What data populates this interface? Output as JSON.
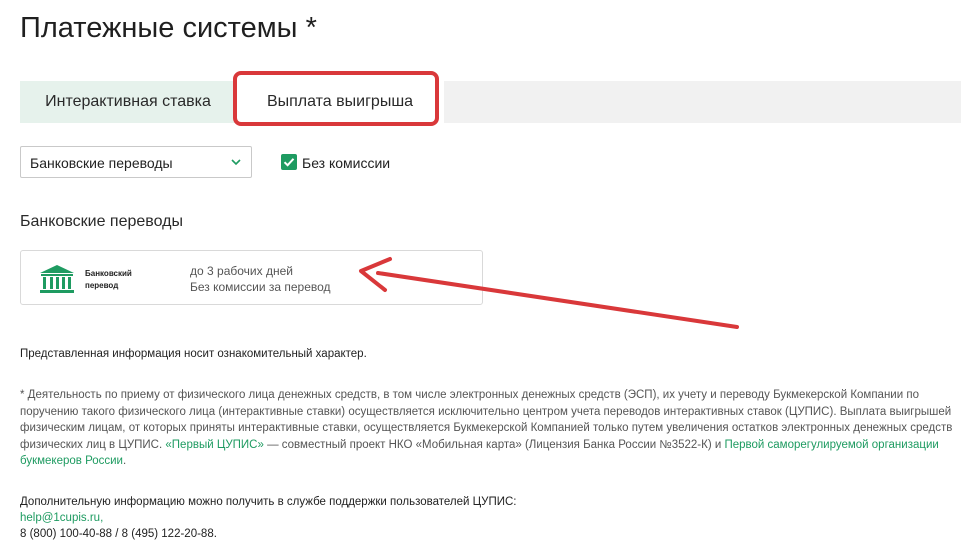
{
  "header": {
    "title": "Платежные системы *"
  },
  "tabs": [
    {
      "label": "Интерактивная ставка"
    },
    {
      "label": "Выплата выигрыша"
    }
  ],
  "filters": {
    "method_select_value": "Банковские переводы",
    "no_commission_label": "Без комиссии",
    "no_commission_checked": true
  },
  "section": {
    "heading": "Банковские переводы",
    "card": {
      "name_line1": "Банковский",
      "name_line2": "перевод",
      "line1": "до 3 рабочих дней",
      "line2": "Без комиссии за перевод"
    }
  },
  "notice": "Представленная информация носит ознакомительный характер.",
  "footnote": {
    "text1": "* Деятельность по приему от физического лица денежных средств, в том числе электронных денежных средств (ЭСП), их учету и переводу Букмекерской Компании по поручению такого физического лица (интерактивные ставки) осуществляется исключительно центром учета переводов интерактивных ставок (ЦУПИС). Выплата выигрышей физическим лицам, от которых приняты интерактивные ставки, осуществляется Букмекерской Компанией только путем увеличения остатков электронных денежных средств физических лиц в ЦУПИС. ",
    "link1": "«Первый ЦУПИС»",
    "text2": " — совместный проект НКО «Мобильная карта» (Лицензия Банка России №3522-К) и ",
    "link2": "Первой саморегулируемой организации букмекеров России",
    "text3": "."
  },
  "support": {
    "line1": "Дополнительную информацию можно получить в службе поддержки пользователей ЦУПИС:",
    "email": "help@1cupis.ru,",
    "phones": "8 (800) 100-40-88 / 8 (495) 122-20-88."
  },
  "colors": {
    "accent_green": "#1e9b61",
    "annotation_red": "#d9383a",
    "tab_inactive_bg": "#e6f2ec"
  }
}
